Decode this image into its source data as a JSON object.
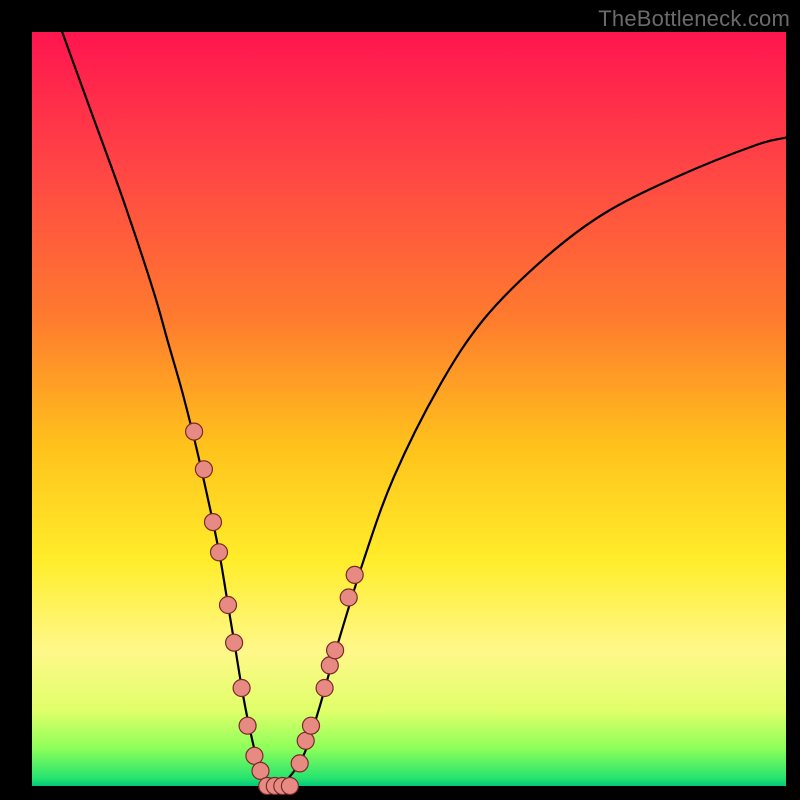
{
  "watermark": "TheBottleneck.com",
  "colors": {
    "frame": "#000000",
    "gradient_top": "#ff154f",
    "gradient_bottom": "#00c878",
    "curve": "#000000",
    "dot_fill": "#e88a84",
    "dot_stroke": "#7a2a24",
    "watermark": "#6b6b6b"
  },
  "chart_data": {
    "type": "line",
    "title": "",
    "xlabel": "",
    "ylabel": "",
    "xlim": [
      0,
      100
    ],
    "ylim": [
      0,
      100
    ],
    "grid": false,
    "legend": false,
    "series": [
      {
        "name": "bottleneck-curve",
        "x": [
          4,
          8,
          12,
          16,
          18,
          20,
          22,
          24,
          25,
          26,
          27,
          28,
          29,
          30,
          31,
          32,
          33,
          34,
          36,
          38,
          40,
          44,
          48,
          54,
          60,
          68,
          76,
          86,
          96,
          100
        ],
        "y": [
          100,
          89,
          78,
          66,
          59,
          52,
          44,
          35,
          30,
          24,
          18,
          12,
          7,
          3,
          1,
          0,
          0,
          1,
          4,
          10,
          17,
          30,
          41,
          53,
          62,
          70,
          76,
          81,
          85,
          86
        ]
      }
    ],
    "markers": [
      {
        "name": "dots-left",
        "x": [
          21.5,
          22.8,
          24.0,
          24.8,
          26.0,
          26.8,
          27.8,
          28.6,
          29.5,
          30.3
        ],
        "y": [
          47,
          42,
          35,
          31,
          24,
          19,
          13,
          8,
          4,
          2
        ]
      },
      {
        "name": "dots-floor",
        "x": [
          31.2,
          32.2,
          33.2,
          34.2
        ],
        "y": [
          0,
          0,
          0,
          0
        ]
      },
      {
        "name": "dots-right",
        "x": [
          35.5,
          36.3,
          37.0,
          38.8,
          39.5,
          40.2,
          42.0,
          42.8
        ],
        "y": [
          3,
          6,
          8,
          13,
          16,
          18,
          25,
          28
        ]
      }
    ]
  }
}
